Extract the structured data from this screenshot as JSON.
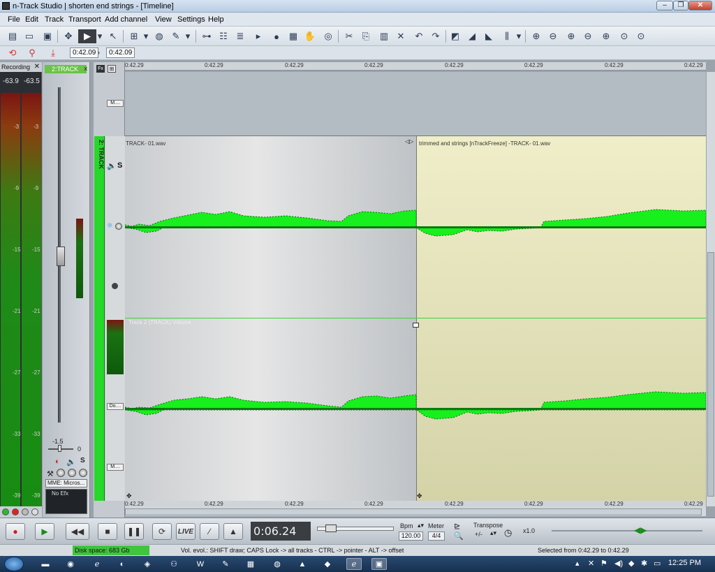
{
  "window": {
    "title": "n-Track Studio | shorten end strings - [Timeline]",
    "minimize": "–",
    "maximize": "❐",
    "close": "✕"
  },
  "menu": [
    "File",
    "Edit",
    "Track",
    "Transport",
    "Add channel",
    "View",
    "Settings",
    "Help"
  ],
  "toolbar2": {
    "time_start": "0:42.09",
    "time_end": "0:42.09"
  },
  "recording_meter": {
    "header": "Recording",
    "close": "✕",
    "peak_left": "-63.9",
    "peak_right": "-63.5",
    "scale": [
      "-3",
      "-9",
      "-15",
      "-21",
      "-27",
      "-33",
      "-39"
    ]
  },
  "fader_strip": {
    "label": "2:TRACK",
    "close": "x",
    "gain_value": "-1.5",
    "pan_value": "0",
    "solo": "S",
    "device": "MME: Micros...",
    "efx": "No Efx"
  },
  "ruler_labels": [
    "0:42.29",
    "0:42.29",
    "0:42.29",
    "0:42.29",
    "0:42.29",
    "0:42.29",
    "0:42.29",
    "0:42.29"
  ],
  "timeline": {
    "fx_label": "Fx",
    "track_name": "2: TRACK",
    "mini_btn_top": "M....",
    "mini_btn_do": "Do....",
    "mini_btn_m": "M....",
    "solo": "S",
    "clip1_label": "TRACK- 01.wav",
    "clip2_label": "trimmed and strings [nTrackFreeze] -TRACK- 01.wav",
    "volume_label": "Track 2 (TRACK) Volume"
  },
  "transport": {
    "live": "LIVE",
    "counter": "0:06.24",
    "bpm_label": "Bpm",
    "bpm_value": "120.00",
    "meter_label": "Meter",
    "meter_value": "4/4",
    "transpose_label": "Transpose",
    "transpose_value": "+/-",
    "speed": "x1.0"
  },
  "status": {
    "disk": "Disk space: 683 Gb",
    "hint": "Vol. evol.: SHIFT draw; CAPS Lock -> all tracks - CTRL -> pointer - ALT -> offset",
    "selection": "Selected from 0:42.29 to 0:42.29"
  },
  "taskbar": {
    "clock": "12:25 PM"
  },
  "colors": {
    "waveform": "#17f01d",
    "track_green": "#27d72a",
    "clip2_bg": "#e6e5bf",
    "counter_bg": "#3a3e42"
  }
}
